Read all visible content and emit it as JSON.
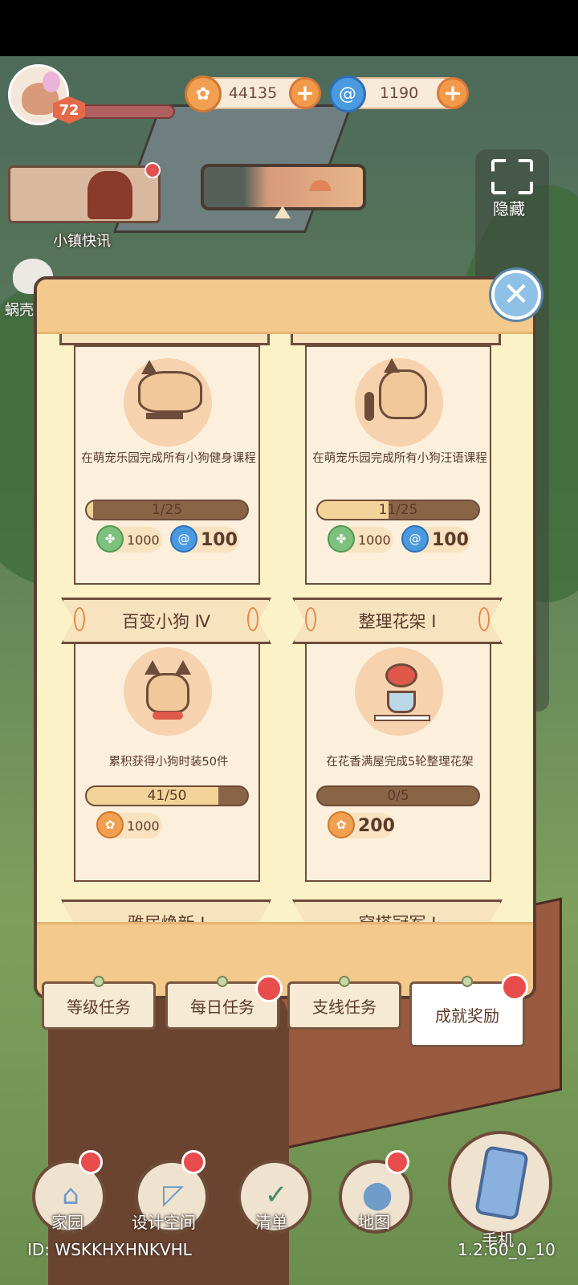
{
  "hud": {
    "level": "72",
    "gold": {
      "icon": "gold-coin-icon",
      "value": "44135",
      "plus": "+"
    },
    "gems": {
      "icon": "blue-swirl-icon",
      "value": "1190",
      "plus": "+"
    },
    "news_label": "小镇快讯",
    "hide_label": "隐藏",
    "left_label": "蜗壳"
  },
  "modal": {
    "close_glyph": "✕",
    "cards": [
      {
        "description": "在萌宠乐园完成所有小狗健身课程",
        "progress_text": "1/25",
        "progress": 0.04,
        "rewards": [
          {
            "icon": "clover-coin-icon",
            "value": "1000"
          },
          {
            "icon": "blue-swirl-icon",
            "value": "100"
          }
        ]
      },
      {
        "description": "在萌宠乐园完成所有小狗汪语课程",
        "progress_text": "11/25",
        "progress": 0.44,
        "rewards": [
          {
            "icon": "clover-coin-icon",
            "value": "1000"
          },
          {
            "icon": "blue-swirl-icon",
            "value": "100"
          }
        ]
      },
      {
        "title": "百变小狗 Ⅳ",
        "description": "累积获得小狗时装50件",
        "progress_text": "41/50",
        "progress": 0.82,
        "rewards": [
          {
            "icon": "gold-coin-icon",
            "value": "1000"
          }
        ]
      },
      {
        "title": "整理花架 Ⅰ",
        "description": "在花香满屋完成5轮整理花架",
        "progress_text": "0/5",
        "progress": 0,
        "rewards": [
          {
            "icon": "gold-coin-icon",
            "value": "200"
          }
        ]
      },
      {
        "title": "雅居焕新 Ⅰ"
      },
      {
        "title": "穿搭冠军 Ⅰ"
      }
    ]
  },
  "tabs": [
    {
      "label": "等级任务",
      "active": false,
      "badge": false
    },
    {
      "label": "每日任务",
      "active": false,
      "badge": true
    },
    {
      "label": "支线任务",
      "active": false,
      "badge": false
    },
    {
      "label": "成就奖励",
      "active": true,
      "badge": true
    }
  ],
  "nav": [
    {
      "label": "家园",
      "icon": "house-icon"
    },
    {
      "label": "设计空间",
      "icon": "ruler-icon"
    },
    {
      "label": "清单",
      "icon": "checklist-icon"
    },
    {
      "label": "地图",
      "icon": "map-pin-icon"
    },
    {
      "label": "手机",
      "icon": "phone-icon"
    }
  ],
  "footer": {
    "id_text": "ID: WSKKHXHNKVHL",
    "version": "1.2.60_0_10"
  },
  "colors": {
    "modal_bg": "#fbf2c8",
    "header_bar": "#f3c98c",
    "progress_track": "#8a6446",
    "progress_fill": "#f2d49a",
    "badge_red": "#e84c4c"
  }
}
